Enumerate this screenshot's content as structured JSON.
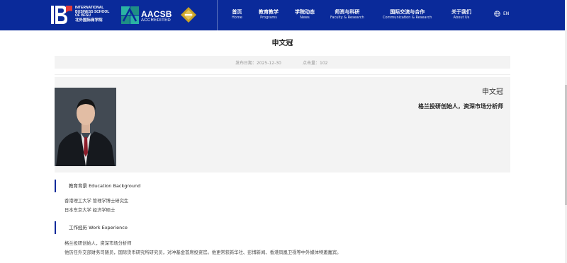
{
  "header": {
    "logo_lines": [
      "INTERNATIONAL",
      "BUSINESS SCHOOL",
      "OF BFSU"
    ],
    "logo_cn": "北外国际商学院",
    "aacsb_word": "AACSB",
    "aacsb_sub": "ACCREDITED",
    "nav": [
      {
        "cn": "首页",
        "en": "Home"
      },
      {
        "cn": "教育教学",
        "en": "Programs"
      },
      {
        "cn": "学院动态",
        "en": "News"
      },
      {
        "cn": "师资与科研",
        "en": "Faculty & Research"
      },
      {
        "cn": "国际交流与合作",
        "en": "Communication & Research"
      },
      {
        "cn": "关于我们",
        "en": "About Us"
      }
    ],
    "lang": "EN"
  },
  "article": {
    "title": "申文冠",
    "published": "发布日期：2025-12-30",
    "clicks": "点击量：102"
  },
  "profile": {
    "name": "申文冠",
    "role": "格兰投研创始人，资深市场分析师"
  },
  "education": {
    "heading": "教育背景 Education Background",
    "lines": [
      "香港理工大学 管理学博士研究生",
      "日本东京大学 经济学硕士"
    ]
  },
  "work": {
    "heading": "工作经历 Work Experience",
    "lines": [
      "格兰投研创始人，资深市场分析师",
      "他历任外交部财务司随员，国际货币研究所研究员，对冲基金首席投资官。他更常获新华社、彭博新闻、香港凤凰卫视等中外媒体特邀嘉宾。"
    ]
  },
  "colors": {
    "brand": "#0a2a9a",
    "panel": "#f3f3f3"
  }
}
